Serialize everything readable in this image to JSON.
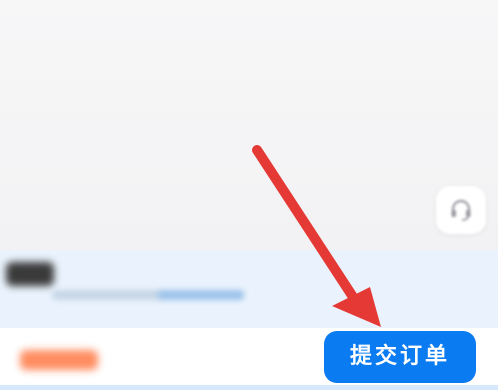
{
  "colors": {
    "page_background": "#f6f6f8",
    "notice_background": "#eaf3fd",
    "primary_button": "#0a7bf0",
    "price_accent": "#ff7a45",
    "annotation_arrow": "#e53935"
  },
  "floating": {
    "customer_service_icon": "headset-icon"
  },
  "bottom_bar": {
    "submit_label": "提交订单"
  },
  "annotation": {
    "icon": "arrow-icon"
  }
}
